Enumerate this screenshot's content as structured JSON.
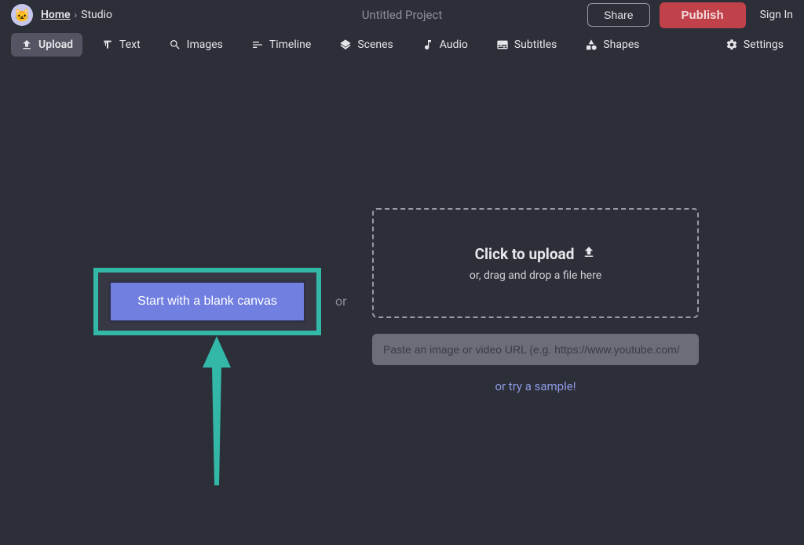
{
  "header": {
    "home": "Home",
    "studio": "Studio",
    "project_title": "Untitled Project",
    "share": "Share",
    "publish": "Publish",
    "signin": "Sign In"
  },
  "toolbar": {
    "upload": "Upload",
    "text": "Text",
    "images": "Images",
    "timeline": "Timeline",
    "scenes": "Scenes",
    "audio": "Audio",
    "subtitles": "Subtitles",
    "shapes": "Shapes",
    "settings": "Settings"
  },
  "main": {
    "blank_canvas": "Start with a blank canvas",
    "or": "or",
    "dropzone_title": "Click to upload",
    "dropzone_sub": "or, drag and drop a file here",
    "url_placeholder": "Paste an image or video URL (e.g. https://www.youtube.com/",
    "sample": "or try a sample!"
  }
}
